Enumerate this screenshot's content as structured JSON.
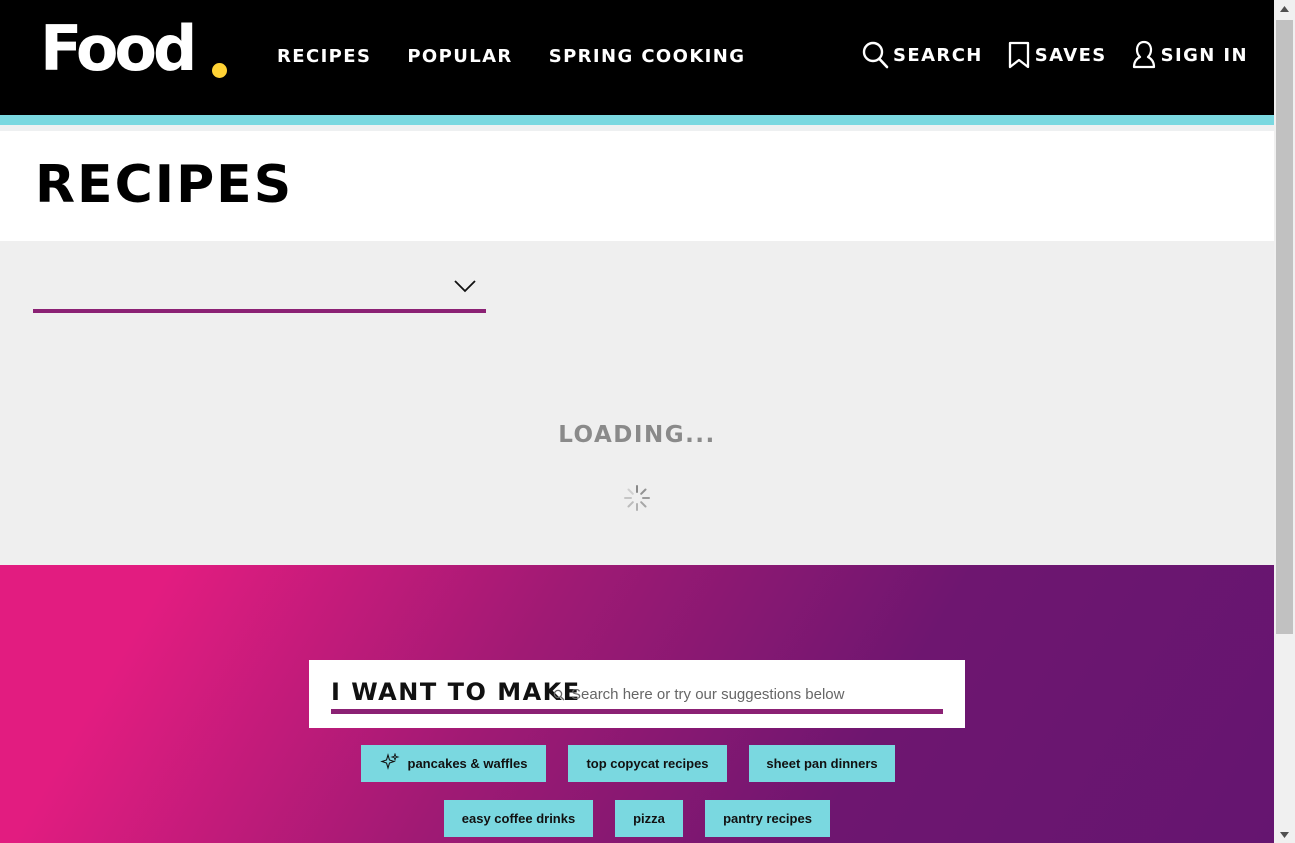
{
  "header": {
    "logo_text": "Food",
    "nav": [
      {
        "label": "RECIPES"
      },
      {
        "label": "POPULAR"
      },
      {
        "label": "SPRING COOKING"
      }
    ],
    "search_label": "SEARCH",
    "saves_label": "SAVES",
    "signin_label": "SIGN IN"
  },
  "page": {
    "title": "RECIPES",
    "loading_text": "LOADING..."
  },
  "promo": {
    "heading": "I WANT TO MAKE",
    "search_placeholder": "Search here or try our suggestions below",
    "chips": [
      {
        "label": "pancakes & waffles",
        "icon": "sparkle-icon"
      },
      {
        "label": "top copycat recipes"
      },
      {
        "label": "sheet pan dinners"
      },
      {
        "label": "easy coffee drinks"
      },
      {
        "label": "pizza"
      },
      {
        "label": "pantry recipes"
      }
    ]
  },
  "colors": {
    "accent_purple": "#8b2174",
    "teal": "#7ad8e0",
    "logo_dot": "#ffd234",
    "gradient_start": "#e21c80",
    "gradient_end": "#651570"
  }
}
